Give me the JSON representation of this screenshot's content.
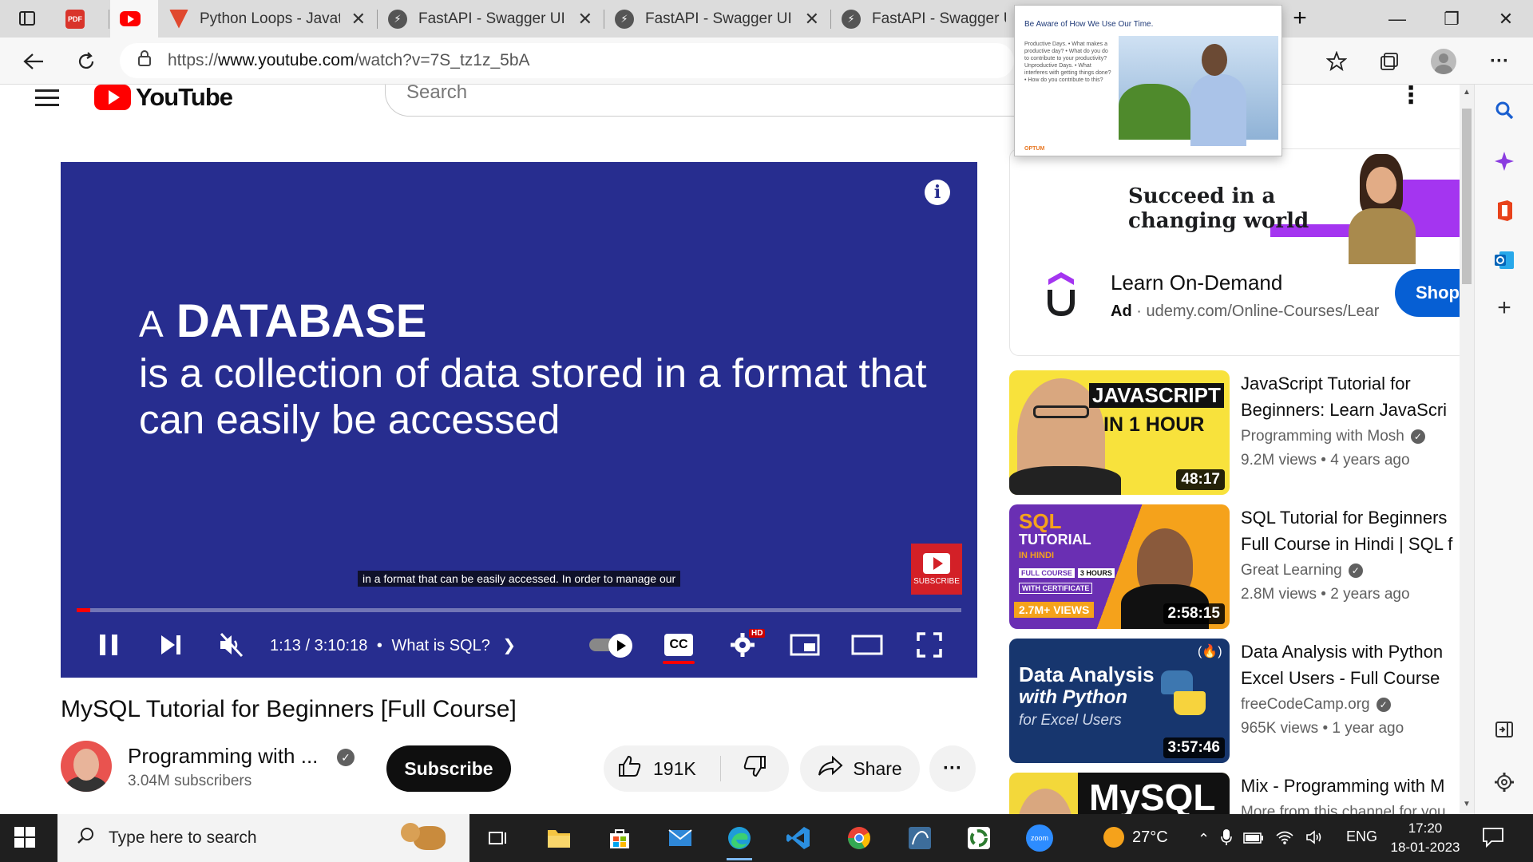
{
  "browser": {
    "tabs": [
      {
        "title": "",
        "favicon": "pdf-icon",
        "color": "#d9342b"
      },
      {
        "title": "",
        "favicon": "youtube-icon",
        "color": "#ff0000",
        "active": true
      },
      {
        "title": "Python Loops - Javatpo",
        "favicon": "javatpoint-icon",
        "color": "#e0492f"
      },
      {
        "title": "FastAPI - Swagger UI",
        "favicon": "fastapi-icon",
        "color": "#555555"
      },
      {
        "title": "FastAPI - Swagger UI",
        "favicon": "fastapi-icon",
        "color": "#555555"
      },
      {
        "title": "FastAPI - Swagger UI",
        "favicon": "fastapi-icon",
        "color": "#555555"
      }
    ],
    "address": {
      "prefix": "https://",
      "domain": "www.youtube.com",
      "path": "/watch?v=7S_tz1z_5bA"
    },
    "preview": {
      "title": "Be Aware of How We Use Our Time.",
      "lines": "Productive Days. • What makes a productive day? • What do you do to contribute to your productivity? Unproductive Days. • What interferes with getting things done? • How do you contribute to this?",
      "brand": "OPTUM"
    }
  },
  "youtube": {
    "logo_text": "YouTube",
    "search_placeholder": "Search",
    "player": {
      "slide_prefix": "A",
      "slide_keyword": "DATABASE",
      "slide_body": "is a collection of data stored in a format that can easily be accessed",
      "caption": "in a format that can be easily accessed. In order to manage our",
      "subscribe_badge": "SUBSCRIBE",
      "time": "1:13 / 3:10:18",
      "chapter": "What is SQL?",
      "hd_badge": "HD",
      "progress_fraction": 0.006
    },
    "video_title": "MySQL Tutorial for Beginners [Full Course]",
    "channel": {
      "name": "Programming with ...",
      "subscribers": "3.04M subscribers"
    },
    "subscribe_label": "Subscribe",
    "likes": "191K",
    "share_label": "Share",
    "ad": {
      "headline_line1": "Succeed in a",
      "headline_line2": "changing world",
      "title": "Learn On-Demand",
      "ad_label": "Ad",
      "url": "udemy.com/Online-Courses/Lear",
      "cta": "Shop"
    },
    "recommendations": [
      {
        "title_line1": "JavaScript Tutorial for",
        "title_line2": "Beginners: Learn JavaScri",
        "channel": "Programming with Mosh",
        "meta": "9.2M views  • 4 years ago",
        "duration": "48:17",
        "thumb_top": "JAVASCRIPT",
        "thumb_bottom": "IN 1 HOUR"
      },
      {
        "title_line1": "SQL Tutorial for Beginners",
        "title_line2": "Full Course in Hindi | SQL f",
        "channel": "Great Learning",
        "meta": "2.8M views  • 2 years ago",
        "duration": "2:58:15",
        "thumb_top": "SQL",
        "thumb_bottom": "TUTORIAL",
        "thumb_hindi": "IN HINDI",
        "thumb_full": "FULL COURSE",
        "thumb_hours": "3 HOURS",
        "thumb_cert": "WITH CERTIFICATE",
        "thumb_views": "2.7M+ VIEWS"
      },
      {
        "title_line1": "Data Analysis with Python",
        "title_line2": "Excel Users - Full Course",
        "channel": "freeCodeCamp.org",
        "meta": "965K views  • 1 year ago",
        "duration": "3:57:46",
        "thumb_top": "Data Analysis",
        "thumb_bottom": "with Python",
        "thumb_sub": "for Excel Users"
      },
      {
        "title_line1": "Mix - Programming with M",
        "title_line2": "More from this channel for you",
        "thumb_top": "MySQL"
      }
    ]
  },
  "taskbar": {
    "search_placeholder": "Type here to search",
    "weather": "27°C",
    "language": "ENG",
    "time": "17:20",
    "date": "18-01-2023"
  }
}
